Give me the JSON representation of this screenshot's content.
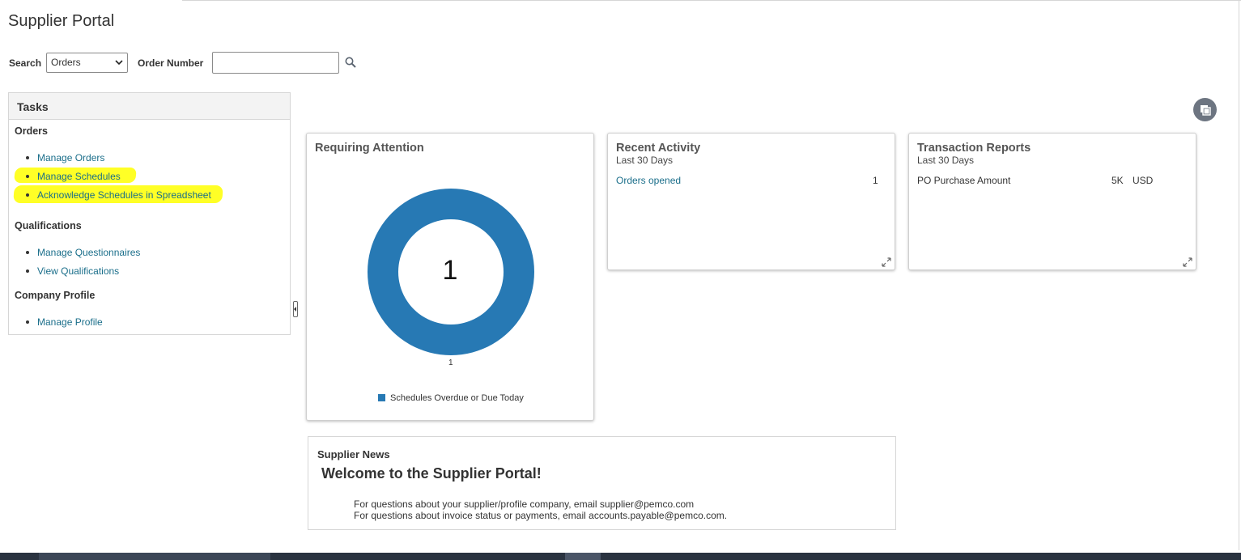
{
  "page_title": "Supplier Portal",
  "search": {
    "label": "Search",
    "selected": "Orders",
    "order_number_label": "Order Number",
    "order_number_value": ""
  },
  "tasks": {
    "header": "Tasks",
    "groups": [
      {
        "title": "Orders",
        "items": [
          "Manage Orders",
          "Manage Schedules",
          "Acknowledge Schedules in Spreadsheet"
        ]
      },
      {
        "title": "Qualifications",
        "items": [
          "Manage Questionnaires",
          "View Qualifications"
        ]
      },
      {
        "title": "Company Profile",
        "items": [
          "Manage Profile"
        ]
      }
    ]
  },
  "requiring_attention": {
    "title": "Requiring Attention",
    "chart_data": {
      "type": "pie",
      "style": "donut",
      "categories": [
        "Schedules Overdue or Due Today"
      ],
      "values": [
        1
      ],
      "center_label": "1",
      "slice_label": "1",
      "legend_position": "bottom",
      "colors": [
        "#2779b4"
      ]
    }
  },
  "recent_activity": {
    "title": "Recent Activity",
    "subtitle": "Last 30 Days",
    "rows": [
      {
        "label": "Orders opened",
        "value": "1"
      }
    ]
  },
  "transaction_reports": {
    "title": "Transaction Reports",
    "subtitle": "Last 30 Days",
    "rows": [
      {
        "label": "PO Purchase Amount",
        "value": "5K",
        "currency": "USD"
      }
    ]
  },
  "supplier_news": {
    "title": "Supplier News",
    "welcome": "Welcome to the Supplier Portal!",
    "lines": [
      "For questions about your supplier/profile company, email supplier@pemco.com",
      "For questions about invoice status or payments, email accounts.payable@pemco.com."
    ]
  },
  "colors": {
    "link": "#1a6e8a",
    "highlight": "#ffff26",
    "accent": "#2779b4"
  }
}
